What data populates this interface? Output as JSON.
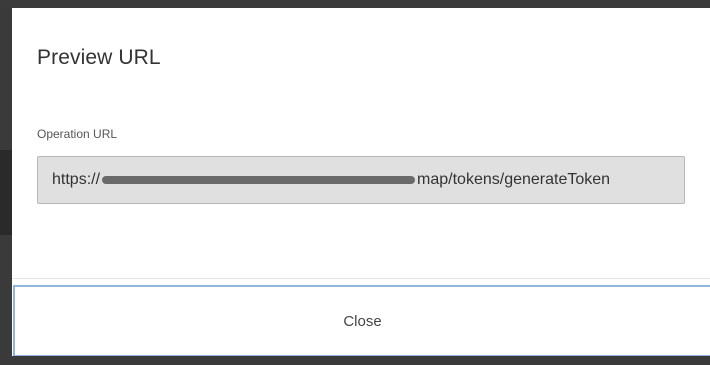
{
  "dialog": {
    "title": "Preview URL",
    "field_label": "Operation URL",
    "url_prefix": "https://",
    "url_suffix": "map/tokens/generateToken",
    "close_label": "Close"
  },
  "colors": {
    "backdrop": "#3a3a3a",
    "dialog_bg": "#ffffff",
    "input_bg": "#e0e0e0",
    "close_border": "#8fb6dd"
  }
}
